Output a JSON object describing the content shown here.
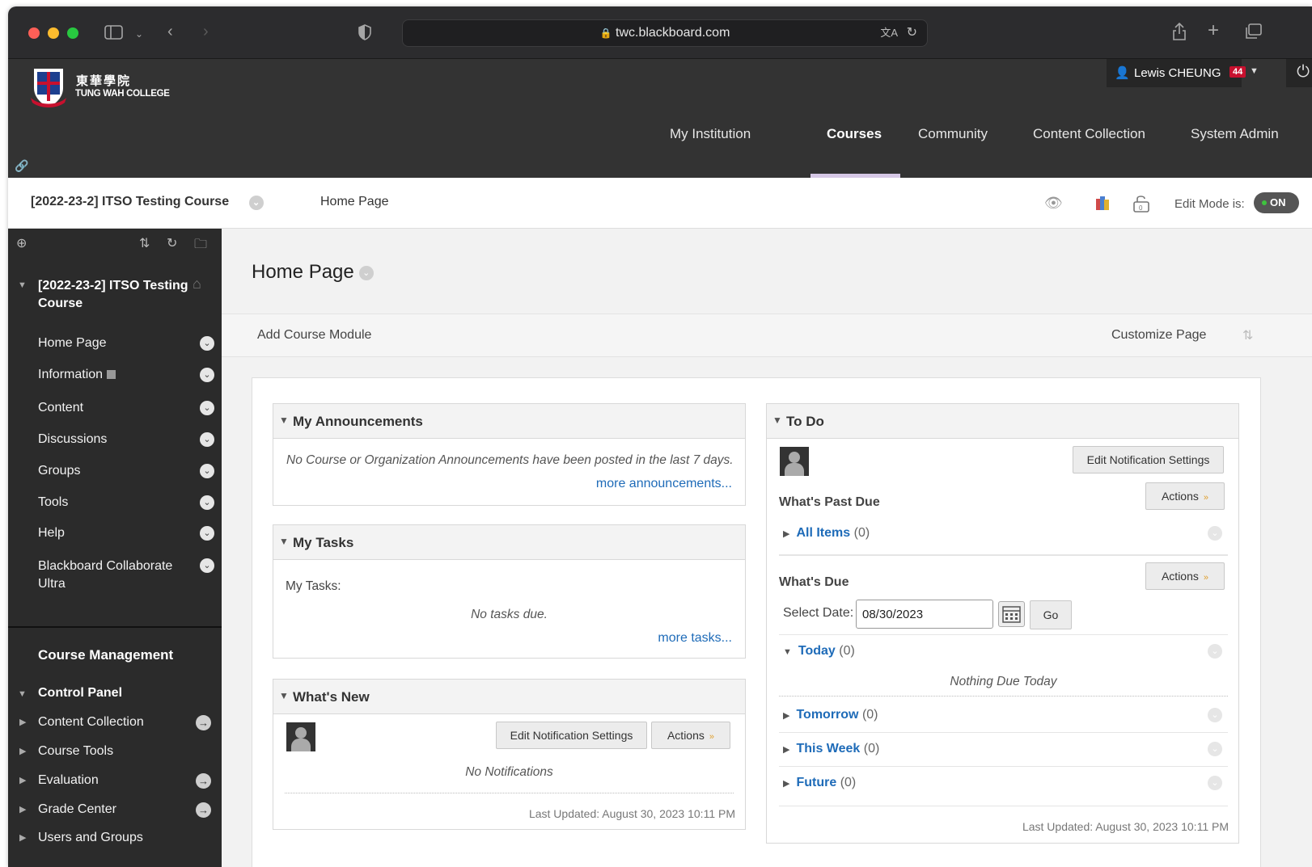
{
  "browser": {
    "url": "twc.blackboard.com"
  },
  "institution": {
    "name_cn": "東華學院",
    "name_en": "TUNG WAH COLLEGE"
  },
  "user": {
    "name": "Lewis CHEUNG",
    "notifications": "44"
  },
  "nav": {
    "tabs": [
      "My Institution",
      "Courses",
      "Community",
      "Content Collection",
      "System Admin"
    ],
    "active": "Courses"
  },
  "breadcrumb": {
    "course": "[2022-23-2] ITSO Testing Course",
    "page": "Home Page",
    "edit_mode_label": "Edit Mode is:",
    "edit_mode_value": "ON"
  },
  "sidebar": {
    "course_title": "[2022-23-2] ITSO Testing Course",
    "items": [
      {
        "label": "Home Page"
      },
      {
        "label": "Information"
      },
      {
        "label": "Content"
      },
      {
        "label": "Discussions"
      },
      {
        "label": "Groups"
      },
      {
        "label": "Tools"
      },
      {
        "label": "Help"
      },
      {
        "label": "Blackboard Collaborate Ultra"
      }
    ],
    "course_management": "Course Management",
    "control_panel": "Control Panel",
    "control_items": [
      {
        "label": "Content Collection"
      },
      {
        "label": "Course Tools"
      },
      {
        "label": "Evaluation"
      },
      {
        "label": "Grade Center"
      },
      {
        "label": "Users and Groups"
      }
    ]
  },
  "main": {
    "title": "Home Page",
    "add_module": "Add Course Module",
    "customize": "Customize Page",
    "announcements": {
      "title": "My Announcements",
      "empty": "No Course or Organization Announcements have been posted in the last 7 days.",
      "more": "more announcements..."
    },
    "tasks": {
      "title": "My Tasks",
      "label": "My Tasks:",
      "empty": "No tasks due.",
      "more": "more tasks..."
    },
    "whatsnew": {
      "title": "What's New",
      "edit_btn": "Edit Notification Settings",
      "actions_btn": "Actions",
      "empty": "No Notifications",
      "updated": "Last Updated: August 30, 2023 10:11 PM"
    },
    "todo": {
      "title": "To Do",
      "edit_btn": "Edit Notification Settings",
      "actions_btn": "Actions",
      "past_due": "What's Past Due",
      "all_items": "All Items",
      "all_items_count": "(0)",
      "whats_due": "What's Due",
      "select_date_label": "Select Date:",
      "date_value": "08/30/2023",
      "go": "Go",
      "today": "Today",
      "today_count": "(0)",
      "nothing_due": "Nothing Due Today",
      "tomorrow": "Tomorrow",
      "tomorrow_count": "(0)",
      "this_week": "This Week",
      "this_week_count": "(0)",
      "future": "Future",
      "future_count": "(0)",
      "updated": "Last Updated: August 30, 2023 10:11 PM"
    }
  }
}
